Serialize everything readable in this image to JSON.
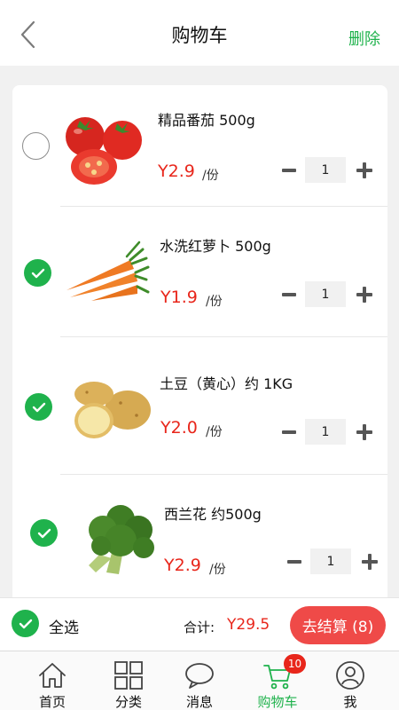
{
  "header": {
    "title": "购物车",
    "delete_label": "删除"
  },
  "cart": {
    "items": [
      {
        "name": "精品番茄  500g",
        "price": "Y2.9",
        "unit": "/份",
        "qty": "1",
        "checked": false
      },
      {
        "name": "水洗红萝卜 500g",
        "price": "Y1.9",
        "unit": "/份",
        "qty": "1",
        "checked": true
      },
      {
        "name": "土豆（黄心）约 1KG",
        "price": "Y2.0",
        "unit": "/份",
        "qty": "1",
        "checked": true
      },
      {
        "name": "西兰花 约500g",
        "price": "Y2.9",
        "unit": "/份",
        "qty": "1",
        "checked": true
      }
    ]
  },
  "footer": {
    "select_all_label": "全选",
    "total_label": "合计:",
    "total": "Y29.5",
    "checkout_label": "去结算 (8)"
  },
  "tabbar": {
    "tabs": [
      {
        "label": "首页",
        "icon": "home-icon"
      },
      {
        "label": "分类",
        "icon": "grid-icon"
      },
      {
        "label": "消息",
        "icon": "chat-bubble-icon"
      },
      {
        "label": "购物车",
        "icon": "cart-icon",
        "badge": "10",
        "active": true
      },
      {
        "label": "我",
        "icon": "user-icon"
      }
    ]
  },
  "colors": {
    "accent_green": "#1fb24c",
    "price_red": "#e8261b",
    "checkout_red": "#ef4a48",
    "page_bg": "#f1f1f1"
  }
}
